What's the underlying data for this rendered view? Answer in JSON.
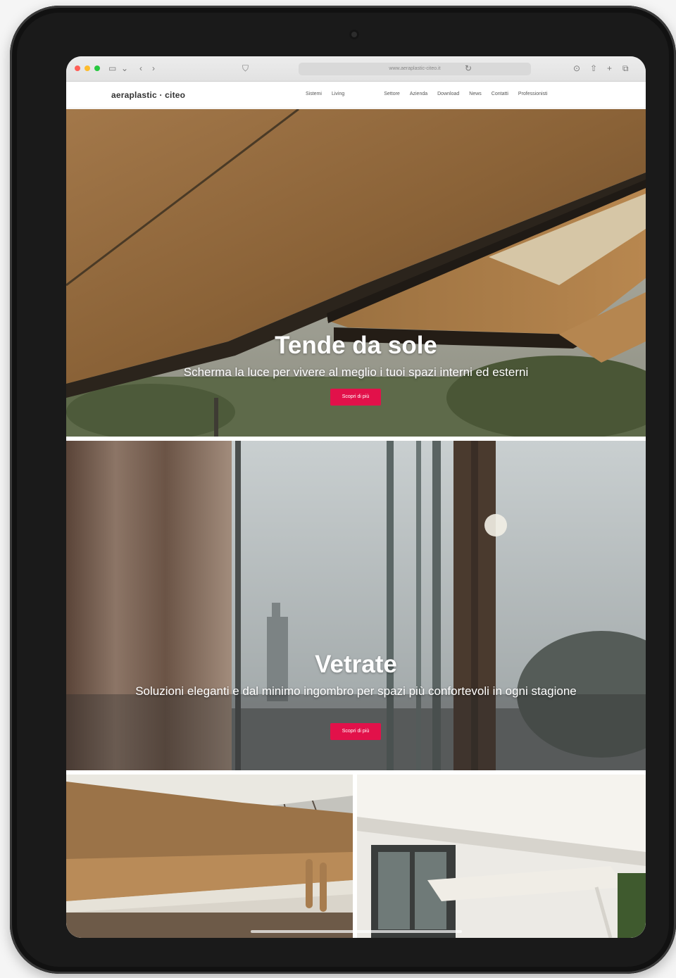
{
  "browser": {
    "url": "www.aeraplastic-citeo.it",
    "traffic_colors": [
      "#ff5f57",
      "#febc2e",
      "#28c840"
    ]
  },
  "site": {
    "logo": "aeraplastic · citeo",
    "nav": [
      "Sistemi",
      "Living",
      "Settore",
      "Azienda",
      "Download",
      "News",
      "Contatti",
      "Professionisti"
    ]
  },
  "panels": [
    {
      "title": "Tende da sole",
      "subtitle": "Scherma la luce per vivere al meglio i tuoi spazi interni ed esterni",
      "cta": "Scopri di più"
    },
    {
      "title": "Vetrate",
      "subtitle": "Soluzioni eleganti e dal minimo ingombro per spazi più confortevoli in ogni stagione",
      "cta": "Scopri di più"
    }
  ],
  "colors": {
    "accent": "#e2114a",
    "device": "#1a1a1a"
  }
}
